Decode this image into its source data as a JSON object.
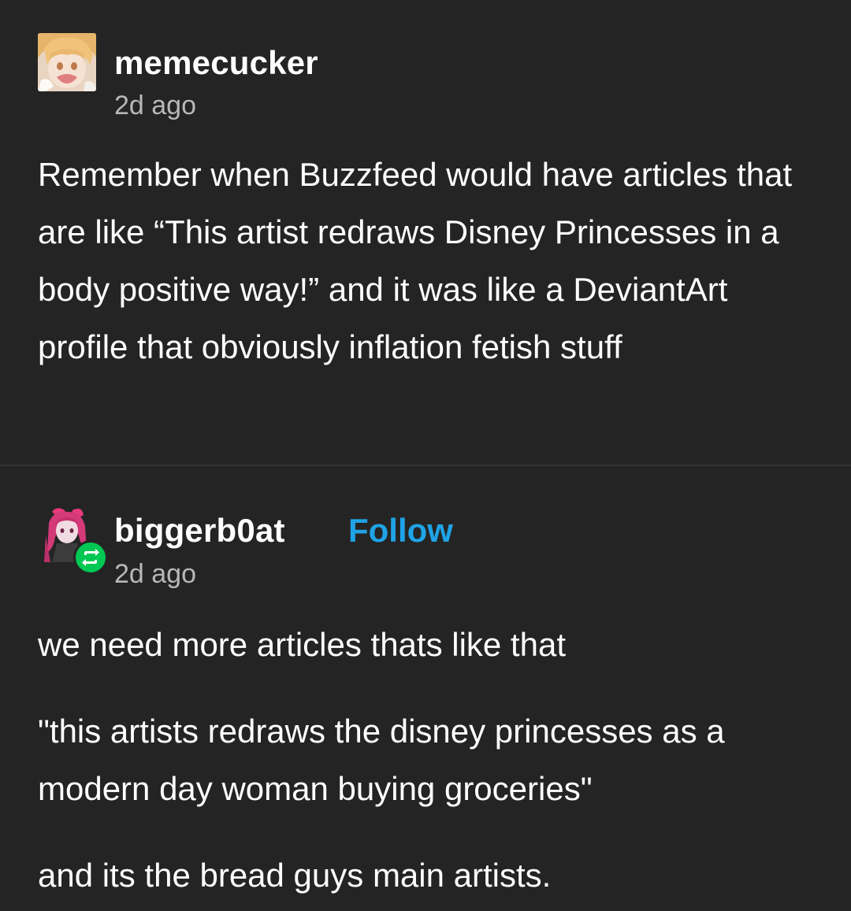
{
  "posts": [
    {
      "username": "memecucker",
      "timestamp": "2d ago",
      "avatar_icon": "anime-avatar-icon",
      "body": "Remember when Buzzfeed would have articles that are like “This artist redraws Disney Princesses in a body positive way!” and it was like a DeviantArt profile that obviously inflation fetish stuff"
    },
    {
      "username": "biggerb0at",
      "follow_label": "Follow",
      "timestamp": "2d ago",
      "avatar_icon": "anime-avatar-icon",
      "reblog_icon": "reblog-icon",
      "paragraphs": [
        "we need more articles thats like that",
        "\"this artists redraws the disney princesses as a modern day woman buying groceries\"",
        "and its the bread guys main artists."
      ]
    }
  ],
  "colors": {
    "background": "#242424",
    "follow": "#1fa3e6",
    "reblog_badge": "#00c853"
  }
}
